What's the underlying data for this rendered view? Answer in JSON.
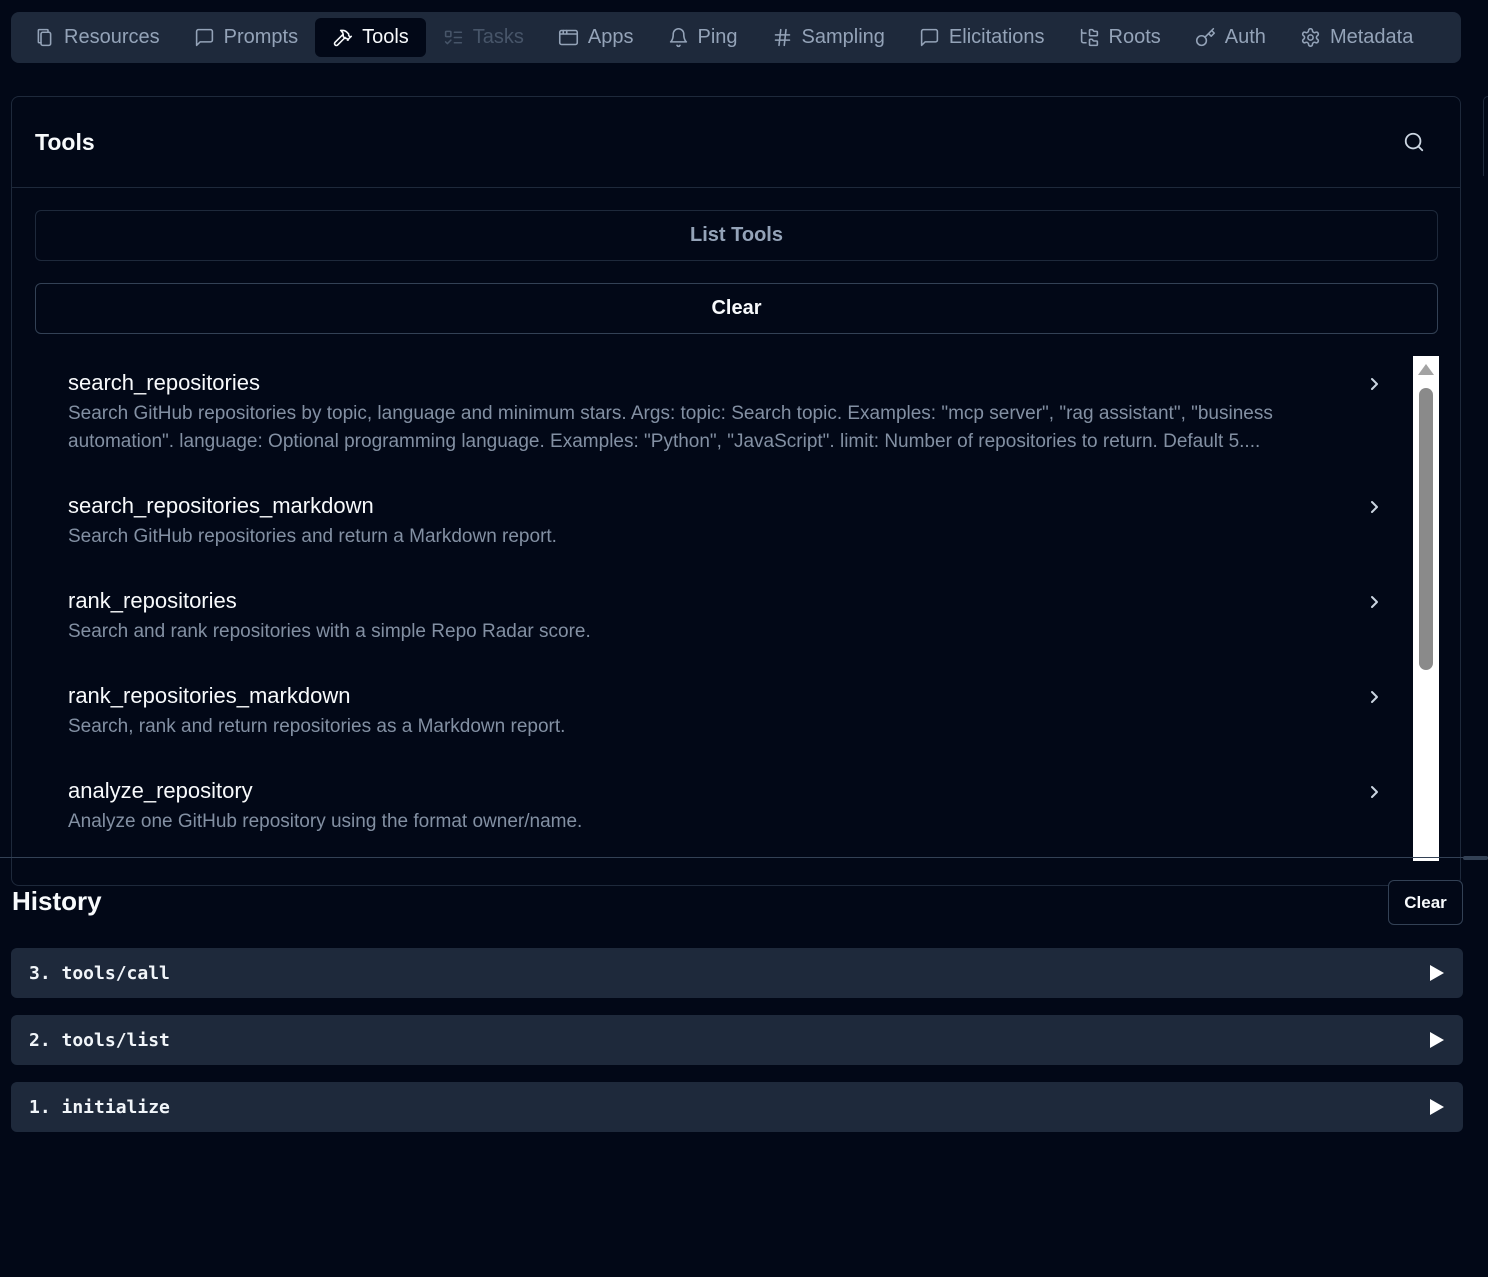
{
  "tabs": [
    {
      "label": "Resources",
      "icon": "files-icon",
      "state": "normal"
    },
    {
      "label": "Prompts",
      "icon": "message-square-icon",
      "state": "normal"
    },
    {
      "label": "Tools",
      "icon": "hammer-icon",
      "state": "active"
    },
    {
      "label": "Tasks",
      "icon": "list-todo-icon",
      "state": "disabled"
    },
    {
      "label": "Apps",
      "icon": "app-window-icon",
      "state": "normal"
    },
    {
      "label": "Ping",
      "icon": "bell-icon",
      "state": "normal"
    },
    {
      "label": "Sampling",
      "icon": "hash-icon",
      "state": "normal"
    },
    {
      "label": "Elicitations",
      "icon": "message-square-icon",
      "state": "normal"
    },
    {
      "label": "Roots",
      "icon": "folder-tree-icon",
      "state": "normal"
    },
    {
      "label": "Auth",
      "icon": "key-icon",
      "state": "normal"
    },
    {
      "label": "Metadata",
      "icon": "settings-icon",
      "state": "normal"
    }
  ],
  "tools_panel": {
    "title": "Tools",
    "list_button": "List Tools",
    "clear_button": "Clear",
    "items": [
      {
        "name": "search_repositories",
        "description": "Search GitHub repositories by topic, language and minimum stars. Args: topic: Search topic. Examples: \"mcp server\", \"rag assistant\", \"business automation\". language: Optional programming language. Examples: \"Python\", \"JavaScript\". limit: Number of repositories to return. Default 5...."
      },
      {
        "name": "search_repositories_markdown",
        "description": "Search GitHub repositories and return a Markdown report."
      },
      {
        "name": "rank_repositories",
        "description": "Search and rank repositories with a simple Repo Radar score."
      },
      {
        "name": "rank_repositories_markdown",
        "description": "Search, rank and return repositories as a Markdown report."
      },
      {
        "name": "analyze_repository",
        "description": "Analyze one GitHub repository using the format owner/name."
      }
    ]
  },
  "history": {
    "title": "History",
    "clear_button": "Clear",
    "entries": [
      {
        "label": "3. tools/call"
      },
      {
        "label": "2. tools/list"
      },
      {
        "label": "1. initialize"
      }
    ]
  },
  "colors": {
    "background": "#020817",
    "surface": "#1e293b",
    "muted_text": "#94a3b8"
  }
}
